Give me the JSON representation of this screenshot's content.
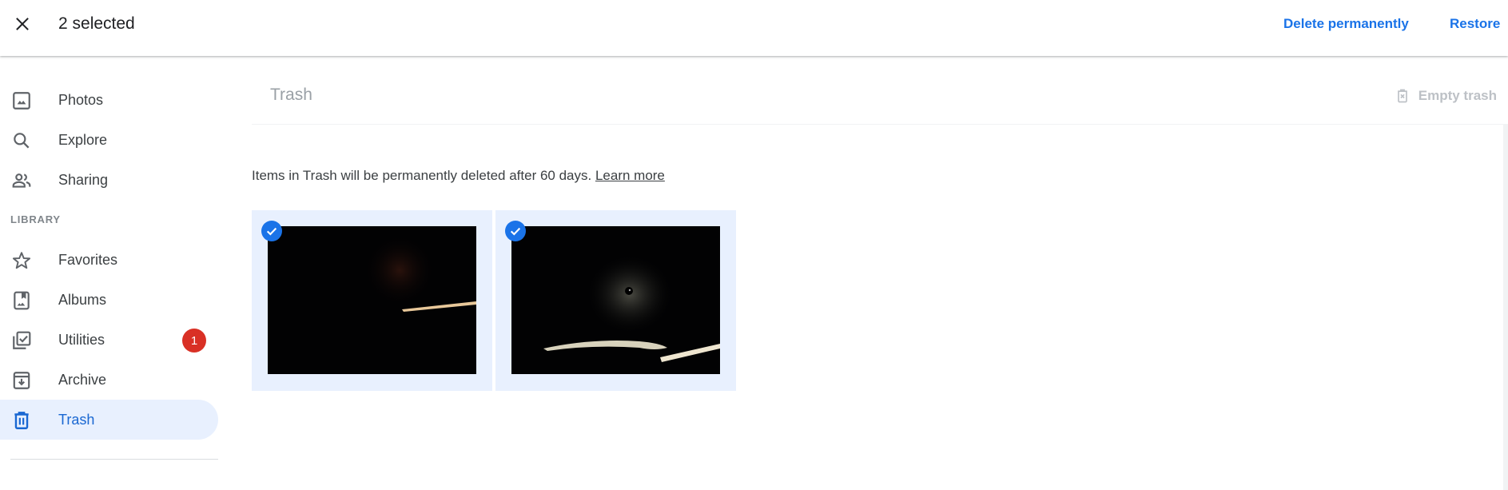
{
  "header": {
    "close_icon": "close-icon",
    "selected_count_label": "2 selected",
    "actions": {
      "delete_permanently": "Delete permanently",
      "restore": "Restore"
    }
  },
  "sidebar": {
    "items": [
      {
        "label": "Photos",
        "icon": "photo-icon"
      },
      {
        "label": "Explore",
        "icon": "search-icon"
      },
      {
        "label": "Sharing",
        "icon": "people-icon"
      }
    ],
    "section_label": "LIBRARY",
    "library_items": [
      {
        "label": "Favorites",
        "icon": "star-icon"
      },
      {
        "label": "Albums",
        "icon": "album-icon"
      },
      {
        "label": "Utilities",
        "icon": "utilities-icon",
        "badge": "1"
      },
      {
        "label": "Archive",
        "icon": "archive-icon"
      },
      {
        "label": "Trash",
        "icon": "trash-icon",
        "active": true
      }
    ]
  },
  "main": {
    "title": "Trash",
    "empty_trash_label": "Empty trash",
    "info_text": "Items in Trash will be permanently deleted after 60 days.",
    "learn_more_label": "Learn more",
    "photos": [
      {
        "selected": true,
        "description": "dark photo with light streak"
      },
      {
        "selected": true,
        "description": "dark photo of cat face with light streak"
      }
    ]
  },
  "colors": {
    "accent": "#1a73e8",
    "active_bg": "#e8f0fe",
    "badge": "#d93025"
  }
}
